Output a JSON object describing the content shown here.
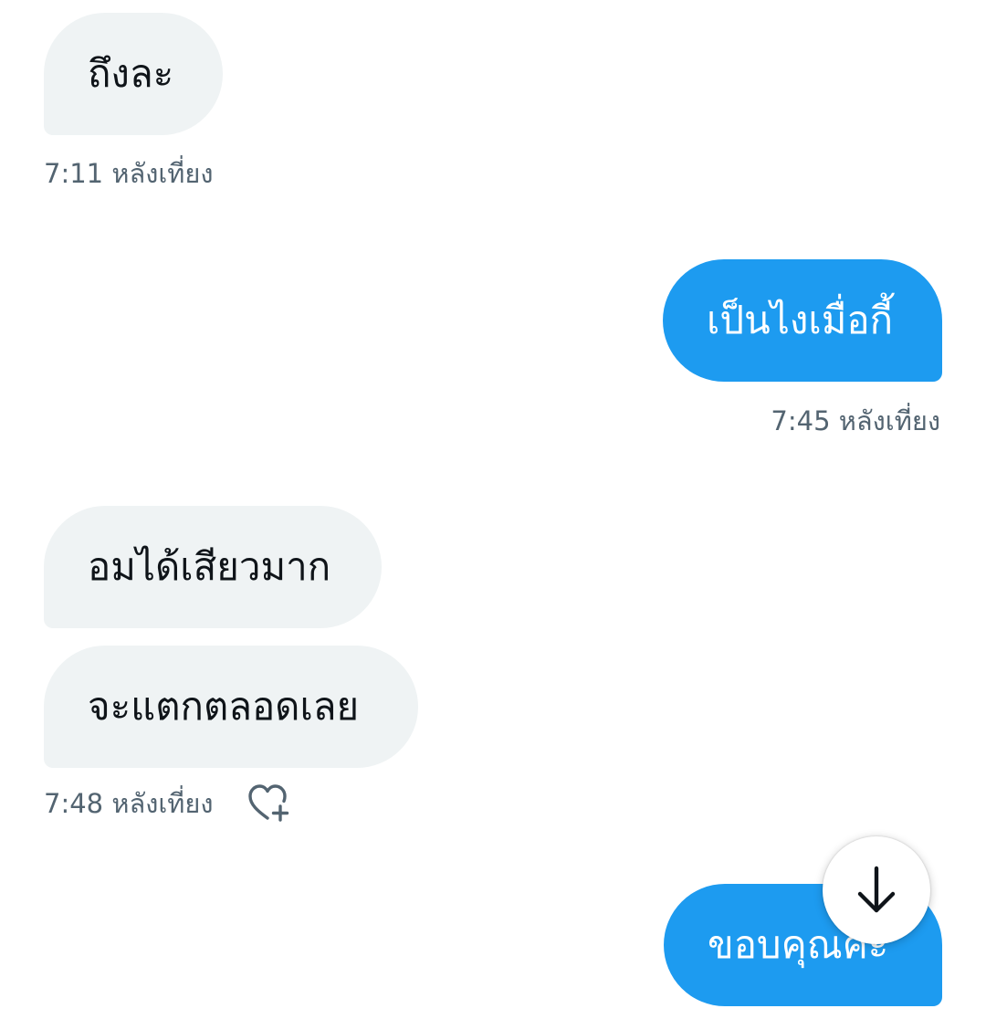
{
  "messages": [
    {
      "direction": "incoming",
      "text": "ถึงละ",
      "time": "7:11 หลังเที่ยง"
    },
    {
      "direction": "outgoing",
      "text": "เป็นไงเมื่อกี้",
      "time": "7:45 หลังเที่ยง"
    },
    {
      "direction": "incoming",
      "text": "อมได้เสียวมาก"
    },
    {
      "direction": "incoming",
      "text": "จะแตกตลอดเลย",
      "time": "7:48 หลังเที่ยง"
    },
    {
      "direction": "outgoing",
      "text": "ขอบคุณค่ะ"
    }
  ],
  "icons": {
    "react": "heart-plus-icon",
    "scroll": "arrow-down-icon"
  },
  "colors": {
    "incoming_bubble": "#eff3f4",
    "outgoing_bubble": "#1d9bf0",
    "timestamp": "#536471",
    "text": "#0f1419"
  }
}
